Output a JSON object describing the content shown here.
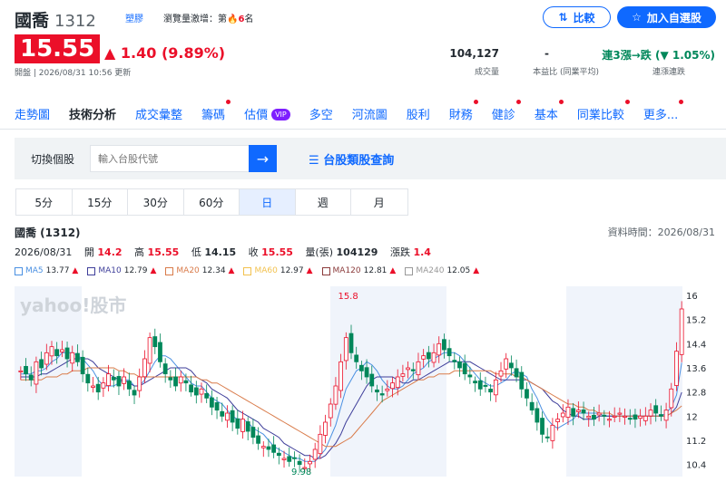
{
  "stock": {
    "name": "國喬",
    "code": "1312",
    "tag_industry": "塑膠",
    "tag_rank_prefix": "瀏覽量激增：第",
    "tag_rank_num": "6",
    "tag_rank_suffix": "名",
    "price": "15.55",
    "change": "1.40 (9.89%)",
    "status_time": "開盤 | 2026/08/31 10:56 更新"
  },
  "header": {
    "compare_label": "比較",
    "watch_label": "加入自選股"
  },
  "stats": [
    {
      "value": "104,127",
      "label": "成交量"
    },
    {
      "value": "-",
      "label": "本益比 (同業平均)"
    },
    {
      "value": "連3漲→跌 (▼ 1.05%)",
      "label": "連漲連跌"
    }
  ],
  "nav": [
    "走勢圖",
    "技術分析",
    "成交彙整",
    "籌碼",
    "估價",
    "多空",
    "河流圖",
    "股利",
    "財務",
    "健診",
    "基本",
    "同業比較",
    "更多..."
  ],
  "vip": "VIP",
  "search": {
    "label": "切換個股",
    "placeholder": "輸入台股代號",
    "category_link": "台股類股查詢"
  },
  "tabs": [
    "5分",
    "15分",
    "30分",
    "60分",
    "日",
    "週",
    "月"
  ],
  "section": {
    "title": "國喬 (1312)",
    "data_time": "資料時間：2026/08/31"
  },
  "ohlc": {
    "date": "2026/08/31",
    "open_l": "開",
    "open": "14.2",
    "high_l": "高",
    "high": "15.55",
    "low_l": "低",
    "low": "14.15",
    "close_l": "收",
    "close": "15.55",
    "vol_l": "量(張)",
    "vol": "104129",
    "chg_l": "漲跌",
    "chg": "1.4"
  },
  "ma": [
    {
      "name": "MA5",
      "value": "13.77",
      "color": "#4a90e2"
    },
    {
      "name": "MA10",
      "value": "12.79",
      "color": "#3e3e9a"
    },
    {
      "name": "MA20",
      "value": "12.34",
      "color": "#d97b4a"
    },
    {
      "name": "MA60",
      "value": "12.97",
      "color": "#f2c14e"
    },
    {
      "name": "MA120",
      "value": "12.81",
      "color": "#8b3b3b"
    },
    {
      "name": "MA240",
      "value": "12.05",
      "color": "#999999"
    }
  ],
  "chart_data": {
    "type": "candlestick",
    "watermark": "yahoo!股市",
    "y_ticks": [
      "16",
      "15.2",
      "14.4",
      "13.6",
      "12.8",
      "12",
      "11.2",
      "10.4"
    ],
    "ylim": [
      10,
      16.3
    ],
    "high_label": "15.8",
    "low_label": "9.98",
    "close": [
      13.5,
      13.4,
      13.2,
      13.8,
      13.6,
      14.1,
      14.3,
      14.0,
      14.2,
      13.9,
      14.1,
      13.8,
      13.4,
      13.1,
      13.0,
      12.8,
      13.1,
      13.4,
      13.2,
      13.0,
      13.3,
      12.9,
      12.7,
      13.3,
      13.9,
      14.6,
      14.3,
      13.8,
      13.4,
      13.2,
      13.0,
      13.3,
      13.1,
      12.8,
      12.7,
      12.9,
      12.6,
      12.3,
      12.2,
      12.0,
      12.1,
      11.8,
      11.6,
      11.9,
      11.5,
      11.3,
      11.1,
      11.0,
      10.9,
      10.8,
      10.7,
      10.6,
      10.5,
      10.6,
      10.4,
      10.3,
      10.5,
      10.9,
      11.4,
      11.8,
      12.4,
      13.0,
      13.8,
      14.6,
      14.1,
      13.8,
      13.5,
      13.3,
      13.0,
      12.8,
      12.7,
      12.9,
      13.1,
      13.3,
      13.4,
      13.6,
      13.5,
      13.8,
      14.0,
      13.9,
      14.1,
      14.4,
      14.2,
      14.0,
      13.8,
      13.6,
      13.4,
      13.3,
      13.1,
      12.9,
      13.0,
      12.8,
      13.2,
      13.5,
      13.9,
      13.6,
      13.3,
      12.9,
      12.6,
      12.2,
      11.8,
      11.4,
      11.3,
      11.7,
      11.9,
      12.1,
      12.3,
      12.0,
      12.2,
      12.1,
      12.0,
      11.9,
      12.1,
      12.0,
      11.9,
      12.0,
      12.1,
      12.0,
      11.9,
      11.9,
      12.0,
      12.0,
      12.2,
      12.1,
      12.0,
      12.2,
      12.9,
      14.15,
      15.55
    ],
    "ma5": [
      13.4,
      13.4,
      13.4,
      13.5,
      13.5,
      13.6,
      13.8,
      13.9,
      14.1,
      14.1,
      14.1,
      14.0,
      13.9,
      13.7,
      13.5,
      13.2,
      13.0,
      13.0,
      13.0,
      13.1,
      13.2,
      13.2,
      13.0,
      13.0,
      13.2,
      13.5,
      13.8,
      14.0,
      14.0,
      13.9,
      13.7,
      13.5,
      13.3,
      13.1,
      13.0,
      13.0,
      12.8,
      12.6,
      12.5,
      12.4,
      12.2,
      12.0,
      11.9,
      11.9,
      11.8,
      11.6,
      11.5,
      11.4,
      11.2,
      11.0,
      10.9,
      10.8,
      10.7,
      10.6,
      10.6,
      10.5,
      10.5,
      10.5,
      10.7,
      10.9,
      11.3,
      11.7,
      12.3,
      12.9,
      13.2,
      13.5,
      13.6,
      13.8,
      13.7,
      13.5,
      13.2,
      13.0,
      12.9,
      12.9,
      13.0,
      13.2,
      13.4,
      13.5,
      13.6,
      13.8,
      13.9,
      14.0,
      14.1,
      14.1,
      14.1,
      14.0,
      13.8,
      13.6,
      13.4,
      13.2,
      13.1,
      13.0,
      13.0,
      13.1,
      13.2,
      13.4,
      13.5,
      13.4,
      13.3,
      12.9,
      12.6,
      12.2,
      11.9,
      11.7,
      11.6,
      11.7,
      11.8,
      11.9,
      12.1,
      12.1,
      12.1,
      12.1,
      12.1,
      12.0,
      12.0,
      12.0,
      12.0,
      12.0,
      12.0,
      12.0,
      12.0,
      12.0,
      12.0,
      12.0,
      12.0,
      12.1,
      12.3,
      12.7,
      13.77
    ],
    "ma10": [
      13.3,
      13.3,
      13.3,
      13.3,
      13.4,
      13.4,
      13.5,
      13.6,
      13.7,
      13.8,
      13.9,
      13.9,
      13.9,
      13.9,
      13.8,
      13.6,
      13.5,
      13.4,
      13.3,
      13.2,
      13.2,
      13.1,
      13.0,
      13.0,
      13.1,
      13.2,
      13.3,
      13.4,
      13.5,
      13.6,
      13.6,
      13.6,
      13.6,
      13.5,
      13.3,
      13.2,
      13.1,
      12.9,
      12.8,
      12.7,
      12.6,
      12.4,
      12.2,
      12.1,
      12.0,
      11.9,
      11.8,
      11.6,
      11.5,
      11.4,
      11.3,
      11.1,
      11.0,
      10.9,
      10.8,
      10.7,
      10.7,
      10.6,
      10.6,
      10.7,
      10.9,
      11.1,
      11.4,
      11.8,
      12.1,
      12.4,
      12.7,
      13.0,
      13.2,
      13.3,
      13.3,
      13.3,
      13.3,
      13.2,
      13.1,
      13.1,
      13.2,
      13.2,
      13.3,
      13.4,
      13.5,
      13.6,
      13.7,
      13.8,
      13.8,
      13.8,
      13.8,
      13.8,
      13.7,
      13.6,
      13.5,
      13.4,
      13.3,
      13.2,
      13.2,
      13.2,
      13.2,
      13.2,
      13.2,
      13.1,
      13.0,
      12.9,
      12.7,
      12.5,
      12.4,
      12.2,
      12.1,
      12.0,
      12.0,
      11.9,
      11.9,
      11.9,
      12.0,
      12.0,
      12.0,
      12.0,
      12.0,
      12.0,
      12.0,
      12.0,
      12.0,
      12.0,
      12.0,
      12.0,
      12.0,
      12.0,
      12.1,
      12.3,
      12.79
    ],
    "ma20": [
      13.2,
      13.2,
      13.2,
      13.2,
      13.2,
      13.3,
      13.3,
      13.3,
      13.4,
      13.4,
      13.5,
      13.5,
      13.5,
      13.6,
      13.6,
      13.6,
      13.6,
      13.6,
      13.6,
      13.5,
      13.5,
      13.4,
      13.4,
      13.3,
      13.3,
      13.3,
      13.3,
      13.3,
      13.3,
      13.3,
      13.3,
      13.3,
      13.3,
      13.3,
      13.3,
      13.2,
      13.2,
      13.1,
      13.1,
      13.0,
      12.9,
      12.8,
      12.7,
      12.6,
      12.5,
      12.4,
      12.3,
      12.2,
      12.1,
      12.0,
      11.9,
      11.8,
      11.7,
      11.6,
      11.5,
      11.4,
      11.3,
      11.2,
      11.1,
      11.0,
      11.0,
      11.0,
      11.1,
      11.2,
      11.3,
      11.5,
      11.7,
      11.9,
      12.1,
      12.3,
      12.5,
      12.6,
      12.7,
      12.8,
      12.9,
      13.0,
      13.1,
      13.2,
      13.2,
      13.3,
      13.3,
      13.4,
      13.4,
      13.4,
      13.5,
      13.5,
      13.5,
      13.5,
      13.5,
      13.5,
      13.5,
      13.5,
      13.4,
      13.4,
      13.4,
      13.4,
      13.3,
      13.3,
      13.2,
      13.1,
      13.0,
      12.9,
      12.8,
      12.7,
      12.6,
      12.5,
      12.4,
      12.4,
      12.3,
      12.3,
      12.2,
      12.2,
      12.1,
      12.1,
      12.1,
      12.0,
      12.0,
      12.0,
      12.0,
      12.0,
      12.0,
      12.0,
      12.0,
      12.0,
      12.0,
      12.0,
      12.1,
      12.2,
      12.34
    ]
  }
}
